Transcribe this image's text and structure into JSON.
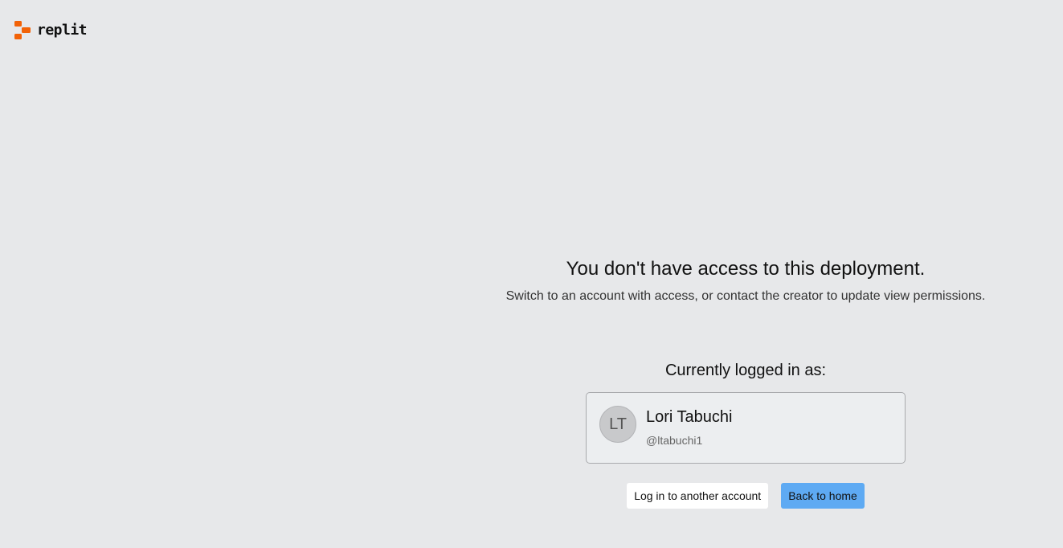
{
  "header": {
    "logo_text": "replit",
    "logo_icon": "replit-logo-icon",
    "brand_color": "#f26207"
  },
  "main": {
    "title": "You don't have access to this deployment.",
    "subtitle": "Switch to an account with access, or contact the creator to update view permissions.",
    "logged_in_label": "Currently logged in as:",
    "account": {
      "initials": "LT",
      "name": "Lori Tabuchi",
      "handle": "@ltabuchi1"
    },
    "actions": {
      "switch_account_label": "Log in to another account",
      "home_label": "Back to home"
    },
    "colors": {
      "background": "#e7e8ea",
      "primary_button": "#5eaaf3"
    }
  }
}
